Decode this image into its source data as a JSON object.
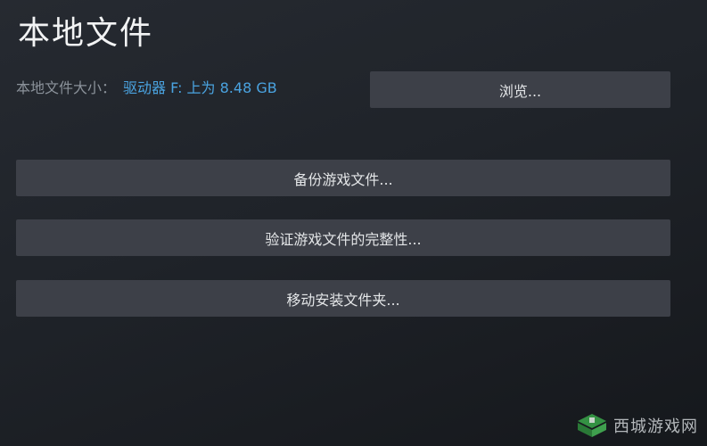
{
  "header": {
    "title": "本地文件"
  },
  "local_files": {
    "size_label": "本地文件大小：",
    "size_value": "驱动器 F: 上为 8.48 GB"
  },
  "buttons": {
    "browse": "浏览...",
    "backup": "备份游戏文件...",
    "verify": "验证游戏文件的完整性...",
    "move": "移动安装文件夹..."
  },
  "watermark": {
    "text": "西城游戏网"
  },
  "colors": {
    "background": "#1f2329",
    "button": "#3d4048",
    "link_blue": "#4aa3e0",
    "label_gray": "#8b929a",
    "watermark_green": "#3aa64a"
  }
}
